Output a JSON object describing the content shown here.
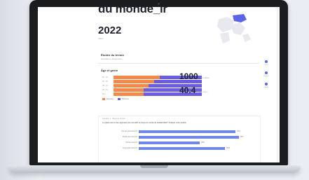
{
  "hero": {
    "title": "du monde_lr",
    "year": "2022",
    "subtitle": "Index"
  },
  "section_terrain": {
    "title": "Études du terrain",
    "subtitle": "Questions - Réponses"
  },
  "age_genre": {
    "title": "Âge et genre",
    "row_labels": [
      "18 - 24",
      "25 - 34",
      "35 - 44",
      "45 - 54",
      "55 +"
    ],
    "orange_share": [
      0.52,
      0.46,
      0.4,
      0.34,
      0.34
    ],
    "legend": [
      "Femmes",
      "Hommes"
    ],
    "colors": {
      "female": "#f18a4b",
      "male": "#6b5ce0"
    }
  },
  "stats": [
    {
      "value": "1000",
      "caption": "répondants"
    },
    {
      "value": "40.4",
      "caption": "âge moyen"
    }
  ],
  "side_nav": [
    "Index",
    "Résultats",
    "Contact"
  ],
  "card": {
    "tag": "Question 1 - Réponse unique",
    "question": "Le Qatar est-il un lieu approprié pour accueillir la Coupe du monde de football 2022 ? Indiquez votre position.",
    "bars": [
      {
        "label": "Pas du tout d'accord",
        "share": 0.92,
        "value": "44%"
      },
      {
        "label": "Plutôt pas d'accord",
        "share": 0.95,
        "value": "45%"
      },
      {
        "label": "Plutôt d'accord",
        "share": 0.58,
        "value": "28%"
      },
      {
        "label": "Tout à fait d'accord",
        "share": 0.82,
        "value": "39%"
      }
    ],
    "bar_color": "#6f88e6"
  }
}
